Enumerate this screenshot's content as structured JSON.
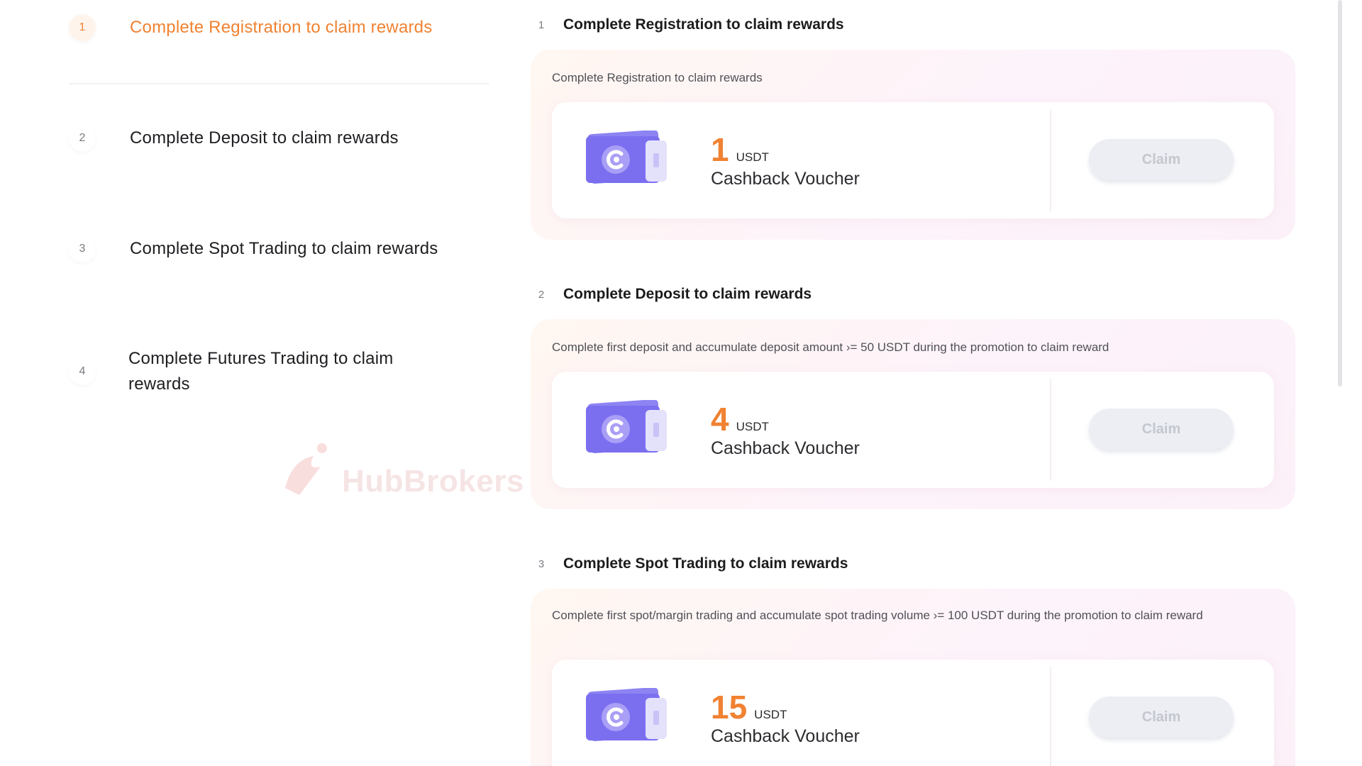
{
  "nav": {
    "items": [
      {
        "number": "1",
        "label": "Complete Registration to claim rewards"
      },
      {
        "number": "2",
        "label": "Complete Deposit to claim rewards"
      },
      {
        "number": "3",
        "label": "Complete Spot Trading to claim rewards"
      },
      {
        "number": "4",
        "label": "Complete Futures Trading to claim rewards"
      }
    ],
    "active_index": 0
  },
  "watermark": {
    "text": "HubBrokers"
  },
  "tasks": [
    {
      "number": "1",
      "title": "Complete Registration to claim rewards",
      "description": "Complete Registration to claim rewards",
      "reward_amount": "1",
      "reward_unit": "USDT",
      "reward_type": "Cashback Voucher",
      "button_label": "Claim"
    },
    {
      "number": "2",
      "title": "Complete Deposit to claim rewards",
      "description": "Complete first deposit and accumulate deposit amount ›= 50 USDT during the promotion to claim reward",
      "reward_amount": "4",
      "reward_unit": "USDT",
      "reward_type": "Cashback Voucher",
      "button_label": "Claim"
    },
    {
      "number": "3",
      "title": "Complete Spot Trading to claim rewards",
      "description": "Complete first spot/margin trading and accumulate spot trading volume ›= 100 USDT during the promotion to claim reward",
      "reward_amount": "15",
      "reward_unit": "USDT",
      "reward_type": "Cashback Voucher",
      "button_label": "Claim"
    }
  ],
  "colors": {
    "accent": "#f08232",
    "voucher": "#7b6ff0",
    "button_disabled": "#eceef3"
  },
  "icons": {
    "voucher": "voucher-ticket-icon"
  }
}
